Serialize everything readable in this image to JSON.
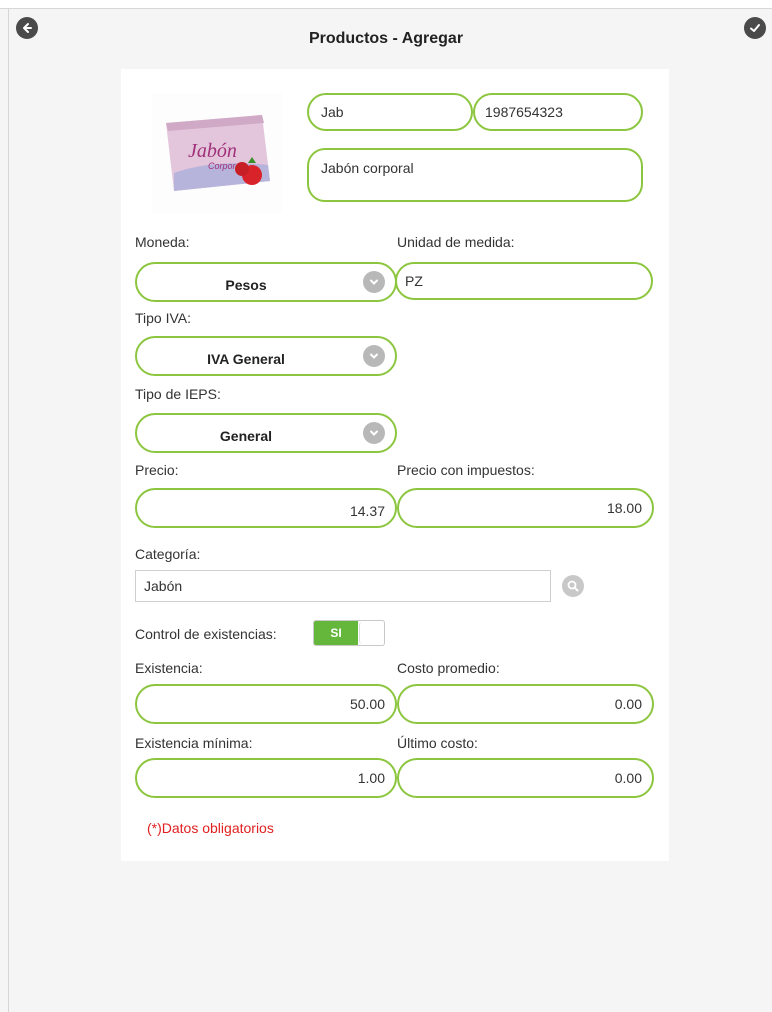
{
  "header": {
    "title": "Productos - Agregar"
  },
  "product": {
    "clave": "Jab",
    "codigo": "1987654323",
    "descripcion": "Jabón corporal",
    "image_text": "Jabón",
    "image_subtext": "Corporal"
  },
  "labels": {
    "moneda": "Moneda:",
    "unidad": "Unidad de medida:",
    "tipo_iva": "Tipo IVA:",
    "tipo_ieps": "Tipo de IEPS:",
    "precio": "Precio:",
    "precio_imp": "Precio con impuestos:",
    "categoria": "Categoría:",
    "control": "Control de existencias:",
    "existencia": "Existencia:",
    "costo_promedio": "Costo promedio:",
    "existencia_minima": "Existencia mínima:",
    "ultimo_costo": "Último costo:"
  },
  "values": {
    "moneda": "Pesos",
    "unidad": "PZ",
    "tipo_iva": "IVA General",
    "tipo_ieps": "General",
    "precio": "14.37",
    "precio_imp": "18.00",
    "categoria": "Jabón",
    "control": "SI",
    "existencia": "50.00",
    "costo_promedio": "0.00",
    "existencia_minima": "1.00",
    "ultimo_costo": "0.00"
  },
  "required_note": "(*)Datos obligatorios",
  "colors": {
    "accent_green": "#8cc63f",
    "toggle_green": "#64b73b",
    "required_red": "#e02020"
  },
  "icons": {
    "back": "arrow-left-circle-icon",
    "save": "check-circle-icon",
    "dropdown": "chevron-down-circle-icon",
    "search": "magnifier-icon"
  }
}
